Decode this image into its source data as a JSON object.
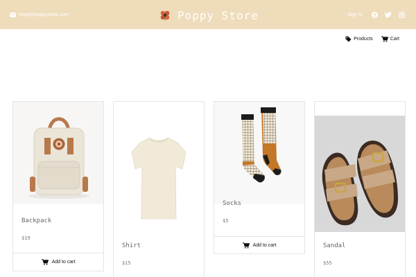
{
  "header": {
    "email": "shop@poppyshop.com",
    "brand_name": "Poppy Store",
    "sign_in": "Sign In",
    "background_color": "#eedcba",
    "icons": [
      "envelope-icon",
      "poppy-logo-icon",
      "facebook-icon",
      "twitter-icon",
      "instagram-icon"
    ]
  },
  "nav": {
    "products_label": "Products",
    "cart_label": "Cart",
    "icons": [
      "tag-icon",
      "cart-icon"
    ]
  },
  "products": [
    {
      "name": "Backpack",
      "price": "$19",
      "button": "Add to cart"
    },
    {
      "name": "Shirt",
      "price": "$15"
    },
    {
      "name": "Socks",
      "price": "$5",
      "button": "Add to cart"
    },
    {
      "name": "Sandal",
      "price": "$55"
    }
  ]
}
